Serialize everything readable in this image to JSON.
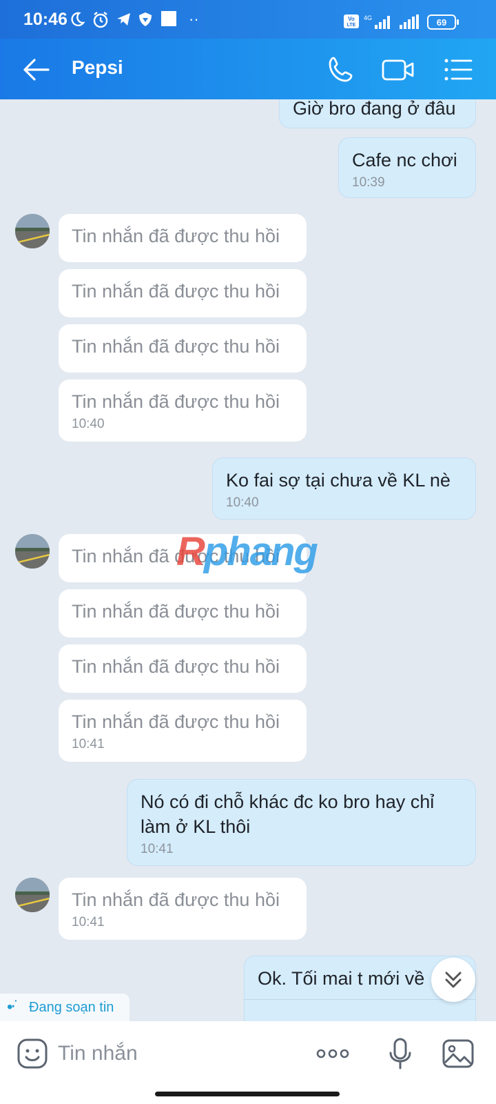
{
  "status_bar": {
    "time": "10:46",
    "volte": "Vo LTE",
    "network": "4G",
    "battery": "69"
  },
  "header": {
    "contact_name": "Pepsi",
    "icons": [
      "back-arrow-icon",
      "phone-icon",
      "video-call-icon",
      "menu-list-icon"
    ]
  },
  "messages": [
    {
      "dir": "out",
      "text": "Giờ bro đang ở đâu",
      "time": ""
    },
    {
      "dir": "out",
      "text": "Cafe nc chơi",
      "time": "10:39"
    },
    {
      "dir": "in",
      "text": "Tin nhắn đã được thu hồi",
      "time": ""
    },
    {
      "dir": "in",
      "text": "Tin nhắn đã được thu hồi",
      "time": ""
    },
    {
      "dir": "in",
      "text": "Tin nhắn đã được thu hồi",
      "time": ""
    },
    {
      "dir": "in",
      "text": "Tin nhắn đã được thu hồi",
      "time": "10:40"
    },
    {
      "dir": "out",
      "text": "Ko fai sợ tại chưa về KL nè",
      "time": "10:40"
    },
    {
      "dir": "in",
      "text": "Tin nhắn đã được thu hồi",
      "time": ""
    },
    {
      "dir": "in",
      "text": "Tin nhắn đã được thu hồi",
      "time": ""
    },
    {
      "dir": "in",
      "text": "Tin nhắn đã được thu hồi",
      "time": ""
    },
    {
      "dir": "in",
      "text": "Tin nhắn đã được thu hồi",
      "time": "10:41"
    },
    {
      "dir": "out",
      "text": "Nó có đi chỗ khác đc ko bro hay chỉ làm ở KL thôi",
      "time": "10:41"
    },
    {
      "dir": "in",
      "text": "Tin nhắn đã được thu hồi",
      "time": "10:41"
    },
    {
      "dir": "out",
      "text": "Ok. Tối mai t mới về",
      "time": ""
    }
  ],
  "watermark": {
    "part1": "R",
    "part2": "phang"
  },
  "typing_indicator": "Đang soạn tin",
  "composer": {
    "placeholder": "Tin nhắn",
    "icons": [
      "emoji-icon",
      "more-icon",
      "microphone-icon",
      "image-icon"
    ]
  },
  "colors": {
    "header": "#1a79e6",
    "chat_background": "#e2e9f1",
    "outgoing_bubble": "#d5ecfb",
    "incoming_bubble": "#ffffff",
    "accent": "#1d9cd4"
  }
}
